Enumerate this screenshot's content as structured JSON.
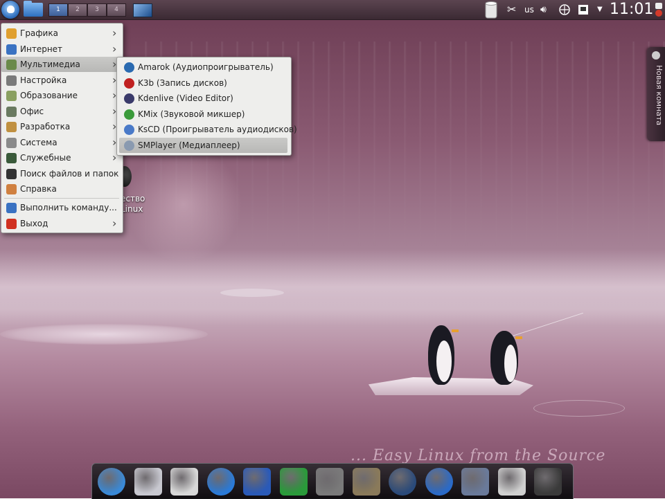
{
  "panel": {
    "pager": [
      "1",
      "2",
      "3",
      "4"
    ],
    "keyboard_layout": "us",
    "clock": "11:01"
  },
  "side_tab": {
    "label": "Новая комната"
  },
  "desktop": {
    "partial_icon_label_1": "ество",
    "partial_icon_label_2": "Linux",
    "slogan": "... Easy Linux from the Source"
  },
  "main_menu": {
    "items": [
      {
        "label": "Графика",
        "icon": "graphics-icon",
        "submenu": true,
        "color": "#e0a030"
      },
      {
        "label": "Интернет",
        "icon": "internet-globe-icon",
        "submenu": true,
        "color": "#3a72c2"
      },
      {
        "label": "Мультимедиа",
        "icon": "multimedia-icon",
        "submenu": true,
        "color": "#6a8a4a"
      },
      {
        "label": "Настройка",
        "icon": "settings-icon",
        "submenu": true,
        "color": "#7a7a7a"
      },
      {
        "label": "Образование",
        "icon": "education-icon",
        "submenu": true,
        "color": "#8aa060"
      },
      {
        "label": "Офис",
        "icon": "office-icon",
        "submenu": true,
        "color": "#6a7a60"
      },
      {
        "label": "Разработка",
        "icon": "development-icon",
        "submenu": true,
        "color": "#c09040"
      },
      {
        "label": "Система",
        "icon": "system-icon",
        "submenu": true,
        "color": "#8a8a8a"
      },
      {
        "label": "Служебные",
        "icon": "utilities-icon",
        "submenu": true,
        "color": "#3a5a3a"
      },
      {
        "label": "Поиск файлов и папок",
        "icon": "find-files-icon",
        "submenu": false,
        "color": "#333333"
      },
      {
        "label": "Справка",
        "icon": "help-icon",
        "submenu": false,
        "color": "#d08040"
      }
    ],
    "extra": [
      {
        "label": "Выполнить команду...",
        "icon": "run-command-icon",
        "submenu": false,
        "color": "#3a72c2"
      },
      {
        "label": "Выход",
        "icon": "logout-icon",
        "submenu": true,
        "color": "#d03020"
      }
    ]
  },
  "submenu": {
    "items": [
      {
        "label": "Amarok (Аудиопроигрыватель)",
        "icon": "amarok-icon",
        "color": "#2a6ab0"
      },
      {
        "label": "K3b (Запись дисков)",
        "icon": "k3b-icon",
        "color": "#c02020"
      },
      {
        "label": "Kdenlive (Video Editor)",
        "icon": "kdenlive-icon",
        "color": "#3a3a6a"
      },
      {
        "label": "KMix (Звуковой микшер)",
        "icon": "kmix-icon",
        "color": "#3a9a3a"
      },
      {
        "label": "KsCD (Проигрыватель аудиодисков)",
        "icon": "kscd-icon",
        "color": "#4a7ac8"
      },
      {
        "label": "SMPlayer (Медиаплеер)",
        "icon": "smplayer-icon",
        "color": "#8a9ab0"
      }
    ]
  },
  "dock": {
    "icons": [
      {
        "name": "chromium-icon",
        "color": "#3a8ad8"
      },
      {
        "name": "mail-icon",
        "color": "#c8c8d0"
      },
      {
        "name": "announce-icon",
        "color": "#d8d8d8"
      },
      {
        "name": "chat-icon",
        "color": "#2a7ad8"
      },
      {
        "name": "writer-icon",
        "color": "#2a5ab8"
      },
      {
        "name": "calc-icon",
        "color": "#2a9a3a"
      },
      {
        "name": "calculator-icon",
        "color": "#7a7a7a"
      },
      {
        "name": "gimp-icon",
        "color": "#8a7a5a"
      },
      {
        "name": "camera-icon",
        "color": "#2a4a7a"
      },
      {
        "name": "wolf-icon",
        "color": "#2a6ac8"
      },
      {
        "name": "video-icon",
        "color": "#6a7a9a"
      },
      {
        "name": "editor-icon",
        "color": "#d0d0d0"
      },
      {
        "name": "terminal-icon",
        "color": "#3a3a3a"
      }
    ]
  }
}
